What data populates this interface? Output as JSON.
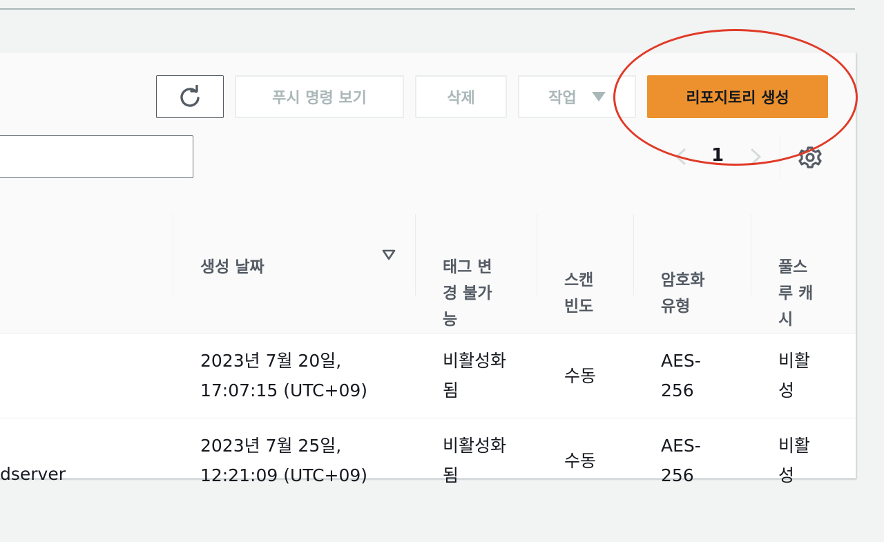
{
  "toolbar": {
    "push_commands_label": "푸시 명령 보기",
    "delete_label": "삭제",
    "actions_label": "작업",
    "create_repository_label": "리포지토리 생성"
  },
  "search": {
    "value": "",
    "placeholder": ""
  },
  "pagination": {
    "current_page": "1"
  },
  "table": {
    "columns": [
      {
        "label": ""
      },
      {
        "label": "생성 날짜",
        "sorted": "descending"
      },
      {
        "label": "태그 변\n경 불가\n능"
      },
      {
        "label": "스캔\n빈도"
      },
      {
        "label": "암호화\n유형"
      },
      {
        "label": "풀스\n루 캐\n시"
      }
    ],
    "rows": [
      {
        "name": "",
        "created": "2023년 7월 20일,\n17:07:15 (UTC+09)",
        "tag_immutability": "비활성화\n됨",
        "scan_frequency": "수동",
        "encryption": "AES-\n256",
        "pull_through_cache": "비활\n성"
      },
      {
        "name": "dserver",
        "created": "2023년 7월 25일,\n12:21:09 (UTC+09)",
        "tag_immutability": "비활성화\n됨",
        "scan_frequency": "수동",
        "encryption": "AES-\n256",
        "pull_through_cache": "비활\n성"
      }
    ]
  },
  "colors": {
    "primary_button": "#ec912d",
    "callout_annotation": "#e03a27",
    "disabled_text": "#aab7b8"
  },
  "icons": {
    "refresh": "refresh-icon",
    "actions_caret": "caret-down-icon",
    "pager_prev": "chevron-left-icon",
    "pager_next": "chevron-right-icon",
    "settings": "gear-icon",
    "sort": "sort-descending-icon"
  }
}
